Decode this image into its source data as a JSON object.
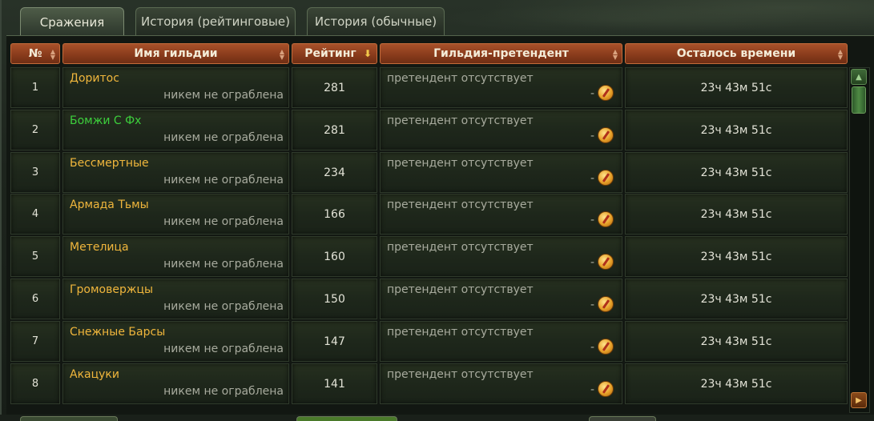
{
  "tabs": [
    {
      "label": "Сражения",
      "active": true
    },
    {
      "label": "История (рейтинговые)",
      "active": false
    },
    {
      "label": "История (обычные)",
      "active": false
    }
  ],
  "columns": {
    "num": "№",
    "guild": "Имя гильдии",
    "rating": "Рейтинг",
    "challenger": "Гильдия-претендент",
    "time_left": "Осталось времени"
  },
  "rows": [
    {
      "num": "1",
      "guild": "Доритос",
      "guild_color": "#f0b63c",
      "status": "никем не ограблена",
      "rating": "281",
      "challenger": "претендент отсутствует",
      "dash": "-",
      "time": "23ч 43м 51с"
    },
    {
      "num": "2",
      "guild": "Бомжи С Фх",
      "guild_color": "#3ccf3c",
      "status": "никем не ограблена",
      "rating": "281",
      "challenger": "претендент отсутствует",
      "dash": "-",
      "time": "23ч 43м 51с"
    },
    {
      "num": "3",
      "guild": "Бессмертные",
      "guild_color": "#f0b63c",
      "status": "никем не ограблена",
      "rating": "234",
      "challenger": "претендент отсутствует",
      "dash": "-",
      "time": "23ч 43м 51с"
    },
    {
      "num": "4",
      "guild": "Армада Тьмы",
      "guild_color": "#f0b63c",
      "status": "никем не ограблена",
      "rating": "166",
      "challenger": "претендент отсутствует",
      "dash": "-",
      "time": "23ч 43м 51с"
    },
    {
      "num": "5",
      "guild": "Метелица",
      "guild_color": "#f0b63c",
      "status": "никем не ограблена",
      "rating": "160",
      "challenger": "претендент отсутствует",
      "dash": "-",
      "time": "23ч 43м 51с"
    },
    {
      "num": "6",
      "guild": "Громовержцы",
      "guild_color": "#f0b63c",
      "status": "никем не ограблена",
      "rating": "150",
      "challenger": "претендент отсутствует",
      "dash": "-",
      "time": "23ч 43м 51с"
    },
    {
      "num": "7",
      "guild": "Снежные Барсы",
      "guild_color": "#f0b63c",
      "status": "никем не ограблена",
      "rating": "147",
      "challenger": "претендент отсутствует",
      "dash": "-",
      "time": "23ч 43м 51с"
    },
    {
      "num": "8",
      "guild": "Акацуки",
      "guild_color": "#f0b63c",
      "status": "никем не ограблена",
      "rating": "141",
      "challenger": "претендент отсутствует",
      "dash": "-",
      "time": "23ч 43м 51с"
    }
  ],
  "icons": {
    "coin": "gold-coin-icon",
    "sort": "sort-arrows-icon",
    "sort_active": "sort-down-arrow-icon",
    "scroll_up": "scroll-up-arrow-icon",
    "scroll_down": "scroll-down-arrow-icon"
  },
  "colors": {
    "header": "#8a3c1c",
    "guild_name": "#f0b63c",
    "guild_name_ally": "#3ccf3c",
    "muted_text": "#a8ab9e"
  }
}
